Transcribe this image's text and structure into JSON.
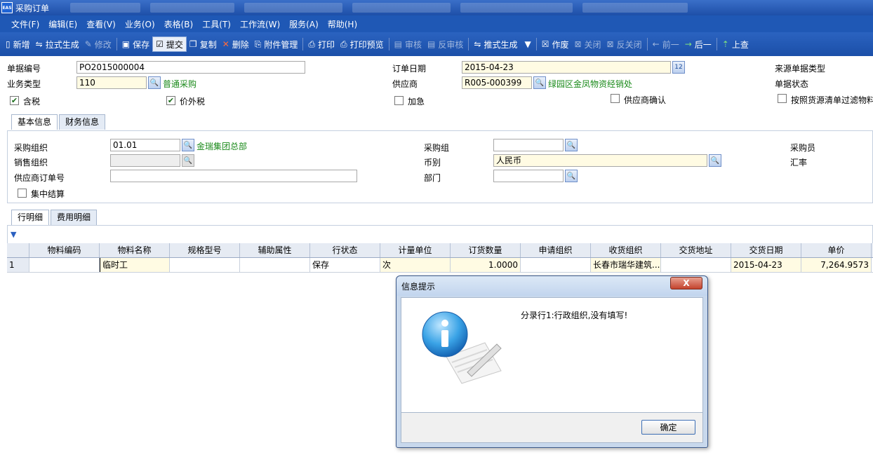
{
  "window": {
    "title": "采购订单",
    "logo": "EAS"
  },
  "menu": [
    "文件(F)",
    "编辑(E)",
    "查看(V)",
    "业务(O)",
    "表格(B)",
    "工具(T)",
    "工作流(W)",
    "服务(A)",
    "帮助(H)"
  ],
  "toolbar": {
    "new": "新增",
    "pull": "拉式生成",
    "modify": "修改",
    "save": "保存",
    "submit": "提交",
    "copy": "复制",
    "delete": "删除",
    "attach": "附件管理",
    "print": "打印",
    "preview": "打印预览",
    "audit": "审核",
    "unaudit": "反审核",
    "push": "推式生成",
    "void": "作废",
    "close": "关闭",
    "unclose": "反关闭",
    "prev": "前一",
    "next": "后一",
    "upcheck": "上查"
  },
  "header": {
    "bill_no_label": "单据编号",
    "bill_no": "PO2015000004",
    "biz_type_label": "业务类型",
    "biz_type_code": "110",
    "biz_type_name": "普通采购",
    "order_date_label": "订单日期",
    "order_date": "2015-04-23",
    "supplier_label": "供应商",
    "supplier_code": "R005-000399",
    "supplier_name": "绿园区金凤物资经销处",
    "source_type_label": "来源单据类型",
    "bill_status_label": "单据状态",
    "tax_label": "含税",
    "extra_tax_label": "价外税",
    "urgent_label": "加急",
    "supplier_confirm_label": "供应商确认",
    "filter_label": "按照货源清单过滤物料"
  },
  "tabs1": [
    "基本信息",
    "财务信息"
  ],
  "basic": {
    "purchase_org_label": "采购组织",
    "purchase_org_code": "01.01",
    "purchase_org_name": "金瑞集团总部",
    "sales_org_label": "销售组织",
    "supplier_order_label": "供应商订单号",
    "central_settle_label": "集中结算",
    "purchase_group_label": "采购组",
    "currency_label": "币别",
    "currency": "人民币",
    "dept_label": "部门",
    "buyer_label": "采购员",
    "rate_label": "汇率"
  },
  "tabs2": [
    "行明细",
    "费用明细"
  ],
  "grid": {
    "columns": [
      "",
      "物料编码",
      "物料名称",
      "规格型号",
      "辅助属性",
      "行状态",
      "计量单位",
      "订货数量",
      "申请组织",
      "收货组织",
      "交货地址",
      "交货日期",
      "单价"
    ],
    "rows": [
      [
        "1",
        "",
        "临时工",
        "",
        "",
        "保存",
        "次",
        "1.0000",
        "",
        "长春市瑞华建筑...",
        "",
        "2015-04-23",
        "7,264.9573"
      ]
    ]
  },
  "dialog": {
    "title": "信息提示",
    "message": "分录行1:行政组织,没有填写!",
    "ok": "确定",
    "close": "X"
  }
}
